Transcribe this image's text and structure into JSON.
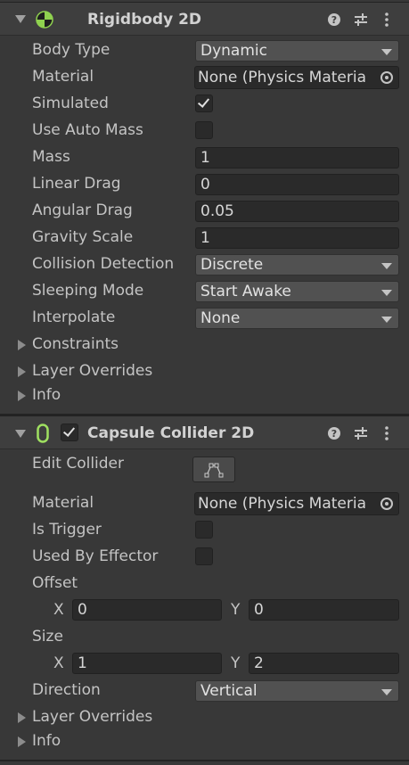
{
  "rigidbody": {
    "title": "Rigidbody 2D",
    "body_type_label": "Body Type",
    "body_type_value": "Dynamic",
    "material_label": "Material",
    "material_value": "None (Physics Materia",
    "simulated_label": "Simulated",
    "simulated_checked": true,
    "use_auto_mass_label": "Use Auto Mass",
    "use_auto_mass_checked": false,
    "mass_label": "Mass",
    "mass_value": "1",
    "linear_drag_label": "Linear Drag",
    "linear_drag_value": "0",
    "angular_drag_label": "Angular Drag",
    "angular_drag_value": "0.05",
    "gravity_scale_label": "Gravity Scale",
    "gravity_scale_value": "1",
    "collision_detection_label": "Collision Detection",
    "collision_detection_value": "Discrete",
    "sleeping_mode_label": "Sleeping Mode",
    "sleeping_mode_value": "Start Awake",
    "interpolate_label": "Interpolate",
    "interpolate_value": "None",
    "constraints_label": "Constraints",
    "layer_overrides_label": "Layer Overrides",
    "info_label": "Info"
  },
  "capsule": {
    "title": "Capsule Collider 2D",
    "enabled": true,
    "edit_collider_label": "Edit Collider",
    "material_label": "Material",
    "material_value": "None (Physics Materia",
    "is_trigger_label": "Is Trigger",
    "is_trigger_checked": false,
    "used_by_effector_label": "Used By Effector",
    "used_by_effector_checked": false,
    "offset_label": "Offset",
    "offset_x_axis": "X",
    "offset_x_value": "0",
    "offset_y_axis": "Y",
    "offset_y_value": "0",
    "size_label": "Size",
    "size_x_axis": "X",
    "size_x_value": "1",
    "size_y_axis": "Y",
    "size_y_value": "2",
    "direction_label": "Direction",
    "direction_value": "Vertical",
    "layer_overrides_label": "Layer Overrides",
    "info_label": "Info"
  },
  "icons": {
    "rigidbody": "rigidbody-2d-icon",
    "capsule": "capsule-collider-2d-icon",
    "help": "help-icon",
    "presets": "presets-icon",
    "menu": "kebab-menu-icon",
    "object_picker": "object-picker-icon",
    "edit_collider": "edit-collider-icon"
  },
  "colors": {
    "rigidbody_icon": "#8fd14f",
    "capsule_icon": "#9fe060",
    "panel_bg": "#383838",
    "header_bg": "#3e3e3e"
  }
}
